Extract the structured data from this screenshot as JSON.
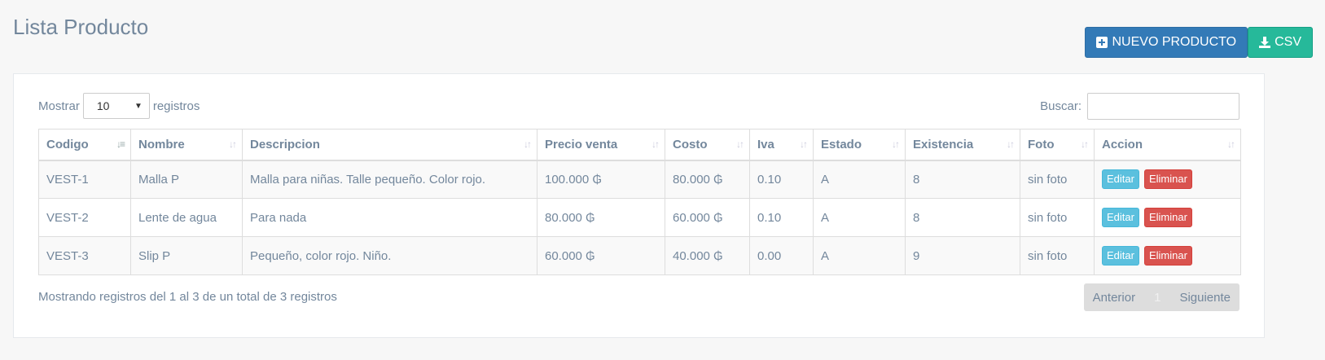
{
  "header": {
    "title": "Lista Producto",
    "new_button": "NUEVO PRODUCTO",
    "csv_button": "CSV",
    "new_icon": "plus-square-icon",
    "csv_icon": "download-icon"
  },
  "controls": {
    "show_label": "Mostrar",
    "page_size": "10",
    "records_label": "registros",
    "search_label": "Buscar:",
    "search_value": ""
  },
  "table": {
    "columns": [
      "Codigo",
      "Nombre",
      "Descripcion",
      "Precio venta",
      "Costo",
      "Iva",
      "Estado",
      "Existencia",
      "Foto",
      "Accion"
    ],
    "rows": [
      {
        "codigo": "VEST-1",
        "nombre": "Malla P",
        "descripcion": "Malla para niñas. Talle pequeño. Color rojo.",
        "precio": "100.000 ₲",
        "costo": "80.000 ₲",
        "iva": "0.10",
        "estado": "A",
        "existencia": "8",
        "foto": "sin foto"
      },
      {
        "codigo": "VEST-2",
        "nombre": "Lente de agua",
        "descripcion": "Para nada",
        "precio": "80.000 ₲",
        "costo": "60.000 ₲",
        "iva": "0.10",
        "estado": "A",
        "existencia": "8",
        "foto": "sin foto"
      },
      {
        "codigo": "VEST-3",
        "nombre": "Slip P",
        "descripcion": "Pequeño, color rojo. Niño.",
        "precio": "60.000 ₲",
        "costo": "40.000 ₲",
        "iva": "0.00",
        "estado": "A",
        "existencia": "9",
        "foto": "sin foto"
      }
    ],
    "edit_label": "Editar",
    "delete_label": "Eliminar"
  },
  "footer": {
    "info": "Mostrando registros del 1 al 3 de un total de 3 registros",
    "prev": "Anterior",
    "page": "1",
    "next": "Siguiente"
  },
  "colors": {
    "primary": "#337ab7",
    "success": "#26b99a",
    "info": "#5bc0de",
    "danger": "#d9534f",
    "text": "#73879c"
  }
}
